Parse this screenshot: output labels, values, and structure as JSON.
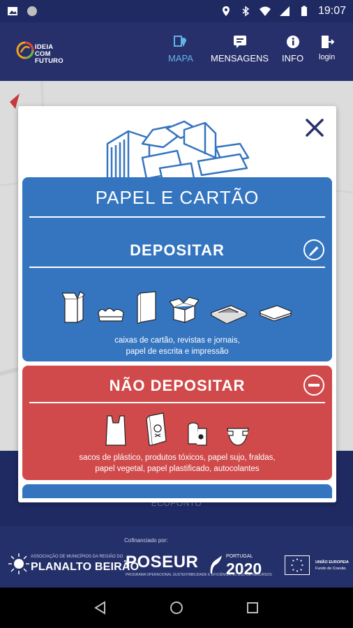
{
  "status_bar": {
    "time": "19:07",
    "icons": [
      "image-icon",
      "circle-icon",
      "location-icon",
      "bluetooth-icon",
      "wifi-icon",
      "signal-icon",
      "battery-icon"
    ]
  },
  "app_bar": {
    "logo_text_line1": "IDEIA",
    "logo_text_line2": "COM",
    "logo_text_line3": "FUTURO",
    "nav": [
      {
        "label": "MAPA",
        "icon": "map-icon",
        "active": true
      },
      {
        "label": "MENSAGENS",
        "icon": "message-icon",
        "active": false
      },
      {
        "label": "INFO",
        "icon": "info-icon",
        "active": false
      },
      {
        "label": "login",
        "icon": "login-icon",
        "active": false
      }
    ]
  },
  "dialog": {
    "title": "PAPEL E CARTÃO",
    "deposit": {
      "heading": "DEPOSITAR",
      "icon": "pencil-circle-icon",
      "caption_line1": "caixas de cartão, revistas e jornais,",
      "caption_line2": "papel de escrita e impressão",
      "item_icons": [
        "open-box-icon",
        "egg-carton-icon",
        "book-icon",
        "open-box-icon",
        "magazine-icon",
        "paper-stack-icon"
      ]
    },
    "no_deposit": {
      "heading": "NÃO DEPOSITAR",
      "icon": "minus-circle-icon",
      "caption_line1": "sacos de plástico, produtos tóxicos, papel sujo, fraldas,",
      "caption_line2": "papel vegetal, papel plastificado, autocolantes",
      "item_icons": [
        "plastic-bag-icon",
        "toxic-product-icon",
        "dirty-paper-icon",
        "diaper-icon"
      ]
    },
    "close_icon": "close-icon"
  },
  "map": {
    "bottom_label": "ECOPONTO"
  },
  "footer": {
    "cofinanced": "Cofinanciado por:",
    "sponsor1_small": "ASSOCIAÇÃO DE MUNICÍPIOS DA REGIÃO DO",
    "sponsor1_big": "PLANALTO BEIRÃO",
    "sponsor2": "POSEUR",
    "sponsor2_sub": "PROGRAMA OPERACIONAL SUSTENTABILIDADE E EFICIÊNCIA NO USO DE RECURSOS",
    "sponsor3_small": "PORTUGAL",
    "sponsor3_big": "2020",
    "sponsor4_line1": "UNIÃO EUROPEIA",
    "sponsor4_line2": "Fundo de Coesão"
  },
  "colors": {
    "navy": "#27306b",
    "blue_panel": "#3575c0",
    "red_panel": "#d04a4b",
    "active_nav": "#63b4e6"
  }
}
